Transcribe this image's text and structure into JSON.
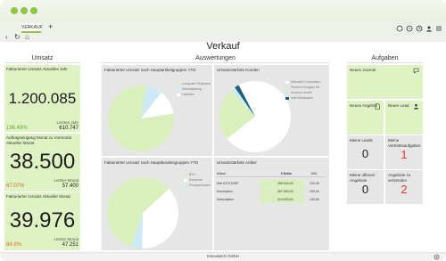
{
  "window": {
    "tab_label": "VERKAUF",
    "tab_add": "+",
    "back": "‹",
    "reload": "↻",
    "home": "⌂",
    "right_icons": [
      "chat-icon",
      "help-icon",
      "clock-icon",
      "user-icon",
      "menu-icon"
    ]
  },
  "page": {
    "title": "Verkauf"
  },
  "columns": {
    "left": "Umsatz",
    "middle": "Auswertungen",
    "right": "Aufgaben"
  },
  "kpis": [
    {
      "label": "Fakturierter Umsatz Aktuelles Jahr",
      "value": "1.200.085",
      "pct": "196.49%",
      "prev_label": "Letztes Jahr",
      "prev_value": "610.747",
      "pct_color": "#6aa82c",
      "fill_height": 0.6
    },
    {
      "label": "Auftragseingang Monat zu Vormonat Aktueller Monat",
      "value": "38.500",
      "pct": "67.07%",
      "prev_label": "Letzter Monat",
      "prev_value": "57.400",
      "pct_color": "#d26a1e",
      "fill_height": 0.6
    },
    {
      "label": "Fakturierter Umsatz Aktueller Monat",
      "value": "39.976",
      "pct": "84.6%",
      "prev_label": "Letzter Monat",
      "prev_value": "47.251",
      "pct_color": "#d26a1e",
      "fill_height": 0.8
    }
  ],
  "charts": {
    "c1_title": "Fakturierter Umsatz nach Hauptartikelgruppen YTD",
    "c1_legend": [
      "Computer Peripherie",
      "Dienstleistung",
      "Lizenzen"
    ],
    "c2_title": "Umsatzstärkste Kunden",
    "c2_legend": [
      "Microsoft Corporation",
      "Pension Hungary Kft.",
      "Amazon GmbH",
      "Intel Wiesbaden"
    ],
    "c3_title": "Fakturierter Umsatz nach Hauptkundengruppen YTD",
    "c3_legend": [
      "B2G",
      "Konzerne",
      "Privatpersonen"
    ],
    "c4_title": "Umsatzstärkste Artikel"
  },
  "chart_data": [
    {
      "type": "pie",
      "title": "Fakturierter Umsatz nach Hauptartikelgruppen YTD",
      "categories": [
        "Computer Peripherie",
        "Dienstleistung",
        "Lizenzen"
      ],
      "values": [
        80,
        8,
        12
      ],
      "colors": [
        "#d9f0bd",
        "#cde9f6",
        "#ffffff"
      ]
    },
    {
      "type": "pie",
      "title": "Umsatzstärkste Kunden",
      "categories": [
        "Microsoft Corporation",
        "Pension Hungary Kft.",
        "Amazon GmbH",
        "Intel Wiesbaden"
      ],
      "values": [
        72,
        24,
        2,
        2
      ],
      "colors": [
        "#ffffff",
        "#d9f0bd",
        "#cde9f6",
        "#1f5f7a"
      ]
    },
    {
      "type": "pie",
      "title": "Fakturierter Umsatz nach Hauptkundengruppen YTD",
      "categories": [
        "B2G",
        "Konzerne",
        "Privatpersonen"
      ],
      "values": [
        58,
        37,
        5
      ],
      "colors": [
        "#d9f0bd",
        "#ffffff",
        "#cde9f6"
      ]
    },
    {
      "type": "table",
      "title": "Umsatzstärkste Artikel",
      "headers": [
        "Artikel",
        "€ Netto",
        "DB1"
      ],
      "rows": [
        [
          "Dell S2721HGF",
          "265.549,00",
          "100,00"
        ],
        [
          "Konzeption",
          "367.550,00",
          "100,00"
        ],
        [
          "Subscription",
          "414.600,00",
          "100,00"
        ]
      ]
    }
  ],
  "tasks": {
    "neues_journal": "Neues Journal",
    "neues_angebot": "Neues Angebot",
    "neuer_lead": "Neuer Lead",
    "meine_leads": "Meine Leads",
    "meine_leads_count": "0",
    "meine_vertriebsaufgaben": "Meine Vertriebsaufgaben",
    "meine_vertriebsaufgaben_count": "1",
    "meine_offenen_angebote": "Meine offenen Angebote",
    "meine_offenen_angebote_count": "0",
    "angebote_zu_versenden": "Angebote zu versenden",
    "angebote_zu_versenden_count": "2",
    "count_color_red": "#d83a2e"
  },
  "status": {
    "company": "Innovatech GmbH",
    "settings_icon": "gear-icon"
  }
}
